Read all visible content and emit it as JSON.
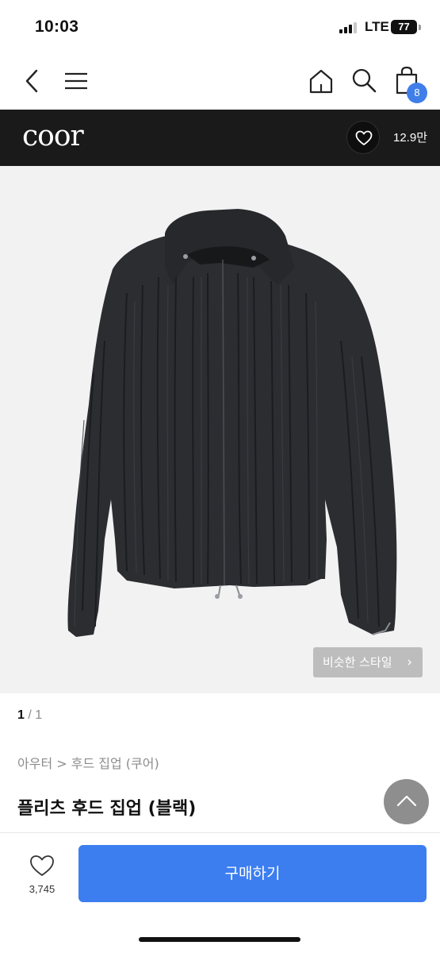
{
  "status_bar": {
    "time": "10:03",
    "network": "LTE",
    "battery": "77"
  },
  "nav": {
    "back_icon": "chevron-left-icon",
    "menu_icon": "hamburger-menu-icon",
    "home_icon": "home-icon",
    "search_icon": "search-icon",
    "cart_icon": "shopping-bag-icon",
    "cart_count": "8"
  },
  "brand": {
    "logo_text": "coor",
    "likes": "12.9만",
    "like_icon": "heart-outline-icon"
  },
  "image": {
    "similar_style_label": "비슷한 스타일",
    "chevron": "›"
  },
  "pager": {
    "current": "1",
    "total": "/ 1"
  },
  "breadcrumb": "아우터 > 후드 집업 (쿠어)",
  "product": {
    "title": "플리츠 후드 집업 (블랙)"
  },
  "bottom_bar": {
    "wish_count": "3,745",
    "buy_label": "구매하기"
  },
  "colors": {
    "accent": "#3c7ef0",
    "badge": "#3f7ee8",
    "brand_bar": "#1a1a1a"
  }
}
